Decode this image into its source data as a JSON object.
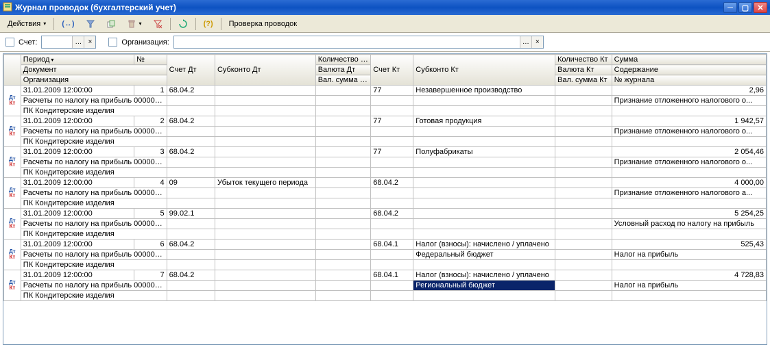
{
  "window": {
    "title": "Журнал проводок (бухгалтерский учет)"
  },
  "toolbar": {
    "actions_label": "Действия",
    "check_label": "Проверка проводок"
  },
  "filter": {
    "acct_label": "Счет:",
    "org_label": "Организация:"
  },
  "headers": {
    "r1": [
      "Период",
      "№",
      "Счет Дт",
      "Субконто Дт",
      "Количество Дт",
      "Счет Кт",
      "Субконто Кт",
      "Количество Кт",
      "Сумма"
    ],
    "r2": [
      "Документ",
      "",
      "",
      "",
      "Валюта Дт",
      "",
      "",
      "Валюта Кт",
      "Содержание"
    ],
    "r3": [
      "Организация",
      "",
      "",
      "",
      "Вал. сумма Дт",
      "",
      "",
      "Вал. сумма Кт",
      "№ журнала"
    ]
  },
  "rows": [
    {
      "period": "31.01.2009 12:00:00",
      "num": "1",
      "acd": "68.04.2",
      "subd": "",
      "qtyd": "",
      "ack": "77",
      "subk": "Незавершенное производство",
      "qtyk": "",
      "sum": "2,96",
      "doc": "Расчеты по налогу на прибыль 000000...",
      "vald": "",
      "valk": "",
      "content": "Признание отложенного налогового о...",
      "org": "ПК Кондитерские изделия",
      "vsumd": "",
      "vsumk": "",
      "jrn": ""
    },
    {
      "period": "31.01.2009 12:00:00",
      "num": "2",
      "acd": "68.04.2",
      "subd": "",
      "qtyd": "",
      "ack": "77",
      "subk": "Готовая продукция",
      "qtyk": "",
      "sum": "1 942,57",
      "doc": "Расчеты по налогу на прибыль 000000...",
      "vald": "",
      "valk": "",
      "content": "Признание отложенного налогового о...",
      "org": "ПК Кондитерские изделия",
      "vsumd": "",
      "vsumk": "",
      "jrn": ""
    },
    {
      "period": "31.01.2009 12:00:00",
      "num": "3",
      "acd": "68.04.2",
      "subd": "",
      "qtyd": "",
      "ack": "77",
      "subk": "Полуфабрикаты",
      "qtyk": "",
      "sum": "2 054,46",
      "doc": "Расчеты по налогу на прибыль 000000...",
      "vald": "",
      "valk": "",
      "content": "Признание отложенного налогового о...",
      "org": "ПК Кондитерские изделия",
      "vsumd": "",
      "vsumk": "",
      "jrn": ""
    },
    {
      "period": "31.01.2009 12:00:00",
      "num": "4",
      "acd": "09",
      "subd": "Убыток текущего периода",
      "qtyd": "",
      "ack": "68.04.2",
      "subk": "",
      "qtyk": "",
      "sum": "4 000,00",
      "doc": "Расчеты по налогу на прибыль 000000...",
      "vald": "",
      "valk": "",
      "content": "Признание отложенного налогового а...",
      "org": "ПК Кондитерские изделия",
      "vsumd": "",
      "vsumk": "",
      "jrn": ""
    },
    {
      "period": "31.01.2009 12:00:00",
      "num": "5",
      "acd": "99.02.1",
      "subd": "",
      "qtyd": "",
      "ack": "68.04.2",
      "subk": "",
      "qtyk": "",
      "sum": "5 254,25",
      "doc": "Расчеты по налогу на прибыль 000000...",
      "vald": "",
      "valk": "",
      "content": "Условный расход по налогу на прибыль",
      "org": "ПК Кондитерские изделия",
      "vsumd": "",
      "vsumk": "",
      "jrn": ""
    },
    {
      "period": "31.01.2009 12:00:00",
      "num": "6",
      "acd": "68.04.2",
      "subd": "",
      "qtyd": "",
      "ack": "68.04.1",
      "subk": "Налог (взносы): начислено / уплачено",
      "qtyk": "",
      "sum": "525,43",
      "doc": "Расчеты по налогу на прибыль 000000...",
      "vald": "",
      "subk2": "Федеральный бюджет",
      "valk": "",
      "content": "Налог на прибыль",
      "org": "ПК Кондитерские изделия",
      "vsumd": "",
      "vsumk": "",
      "jrn": ""
    },
    {
      "period": "31.01.2009 12:00:00",
      "num": "7",
      "acd": "68.04.2",
      "subd": "",
      "qtyd": "",
      "ack": "68.04.1",
      "subk": "Налог (взносы): начислено / уплачено",
      "qtyk": "",
      "sum": "4 728,83",
      "doc": "Расчеты по налогу на прибыль 000000...",
      "vald": "",
      "subk2": "Региональный бюджет",
      "valk": "",
      "content": "Налог на прибыль",
      "org": "ПК Кондитерские изделия",
      "vsumd": "",
      "vsumk": "",
      "jrn": "",
      "selected": true
    }
  ]
}
